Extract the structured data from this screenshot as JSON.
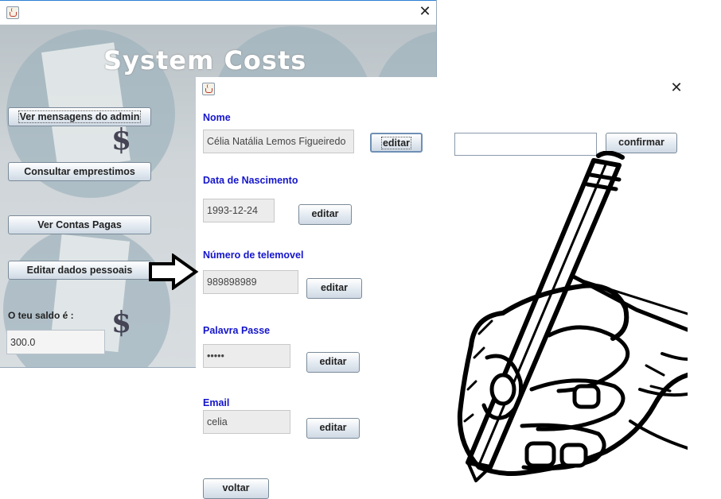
{
  "back_window": {
    "app_title": "System Costs",
    "buttons": {
      "messages": "Ver mensagens do admin",
      "loans": "Consultar emprestimos",
      "paid": "Ver Contas Pagas",
      "edit_personal": "Editar dados pessoais"
    },
    "balance_label": "O teu saldo é :",
    "balance_value": "300.0",
    "currency_symbol": "$",
    "close_symbol": "✕"
  },
  "front_window": {
    "close_symbol": "✕",
    "fields": [
      {
        "label": "Nome",
        "value": "Célia Natália Lemos Figueiredo",
        "button": "editar"
      },
      {
        "label": "Data de Nascimento",
        "value": "1993-12-24",
        "button": "editar"
      },
      {
        "label": "Número de telemovel",
        "value": "989898989",
        "button": "editar"
      },
      {
        "label": "Palavra Passe",
        "value": "•••••",
        "button": "editar"
      },
      {
        "label": "Email",
        "value": "celia",
        "button": "editar"
      }
    ],
    "edit_input_value": "",
    "confirm_button": "confirmar",
    "back_button": "voltar"
  },
  "colors": {
    "label_blue": "#1515cc",
    "title_white": "#ffffff",
    "window_border": "#2d7fd4"
  },
  "icons": [
    "java-cup-icon",
    "close-icon",
    "dollar-icon",
    "arrow-right-icon",
    "hand-writing-illustration"
  ]
}
